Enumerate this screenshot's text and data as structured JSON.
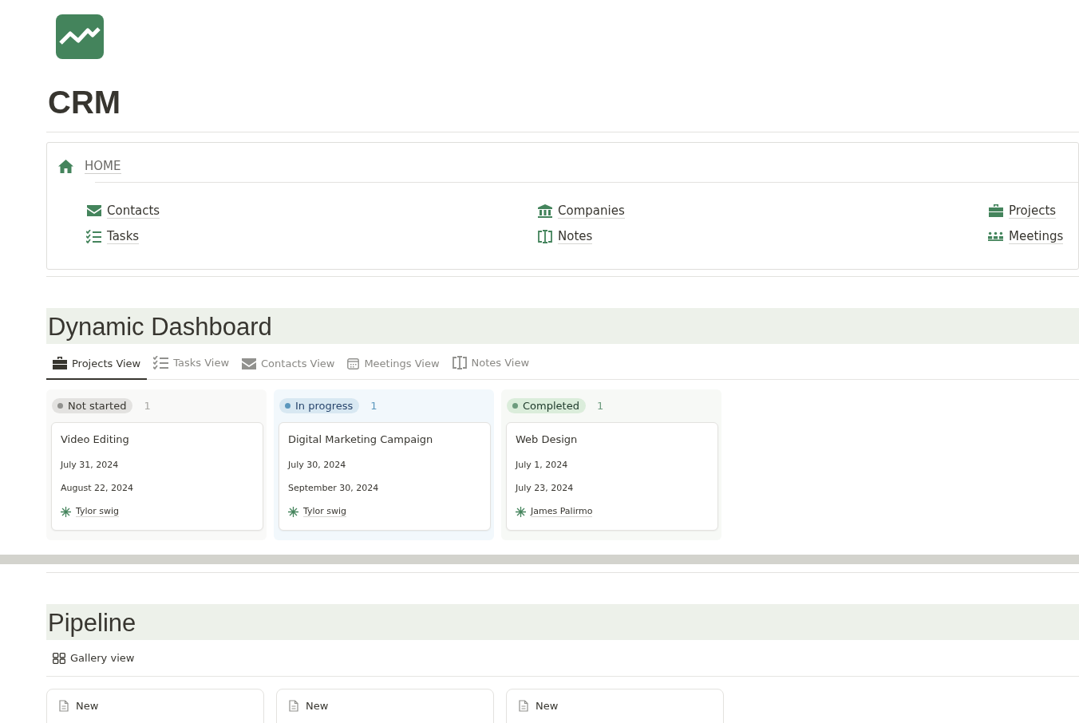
{
  "page": {
    "title": "CRM"
  },
  "home": {
    "heading": "HOME",
    "links": [
      {
        "label": "Contacts"
      },
      {
        "label": "Companies"
      },
      {
        "label": "Projects"
      },
      {
        "label": "Tasks"
      },
      {
        "label": "Notes"
      },
      {
        "label": "Meetings"
      }
    ]
  },
  "dashboard": {
    "heading": "Dynamic Dashboard",
    "tabs": [
      {
        "label": "Projects View",
        "selected": true
      },
      {
        "label": "Tasks View",
        "selected": false
      },
      {
        "label": "Contacts View",
        "selected": false
      },
      {
        "label": "Meetings View",
        "selected": false
      },
      {
        "label": "Notes View",
        "selected": false
      }
    ],
    "groups": [
      {
        "kind": "not_started",
        "status": "Not started",
        "color": "#91918e",
        "count": "1",
        "cards": [
          {
            "title": "Video Editing",
            "start": "July 31, 2024",
            "end": "August 22, 2024",
            "owner": "Tylor swig"
          }
        ]
      },
      {
        "kind": "in_progress",
        "status": "In progress",
        "color": "#5b97bd",
        "count": "1",
        "cards": [
          {
            "title": "Digital Marketing Campaign",
            "start": "July 30, 2024",
            "end": "September 30, 2024",
            "owner": "Tylor swig"
          }
        ]
      },
      {
        "kind": "completed",
        "status": "Completed",
        "color": "#6c9b7d",
        "count": "1",
        "cards": [
          {
            "title": "Web Design",
            "start": "July 1, 2024",
            "end": "July 23, 2024",
            "owner": "James Palirmo"
          }
        ]
      }
    ]
  },
  "pipeline": {
    "heading": "Pipeline",
    "view": "Gallery view",
    "cards": [
      {
        "title": "New"
      },
      {
        "title": "New"
      },
      {
        "title": "New"
      }
    ]
  }
}
